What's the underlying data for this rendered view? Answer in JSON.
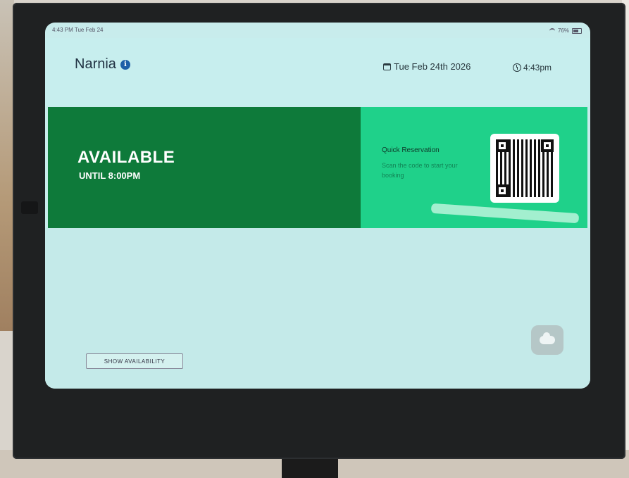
{
  "status_bar": {
    "time_date": "4:43 PM  Tue Feb 24",
    "battery": "76%"
  },
  "header": {
    "room_name": "Narnia",
    "date": "Tue Feb 24th 2026",
    "time": "4:43pm"
  },
  "status": {
    "state": "AVAILABLE",
    "until": "UNTIL 8:00PM"
  },
  "quick_reservation": {
    "title": "Quick Reservation",
    "subtitle": "Scan the code to start your booking"
  },
  "footer": {
    "show_availability": "SHOW AVAILABILITY"
  },
  "colors": {
    "available_green": "#0e7a3a",
    "quick_panel_green": "#1fd18a",
    "screen_background": "#c8ecec",
    "info_blue": "#1e5fa8"
  },
  "icons": [
    "info-icon",
    "calendar-icon",
    "clock-icon",
    "qr-code-icon",
    "cloud-icon",
    "wifi-icon",
    "battery-icon"
  ]
}
